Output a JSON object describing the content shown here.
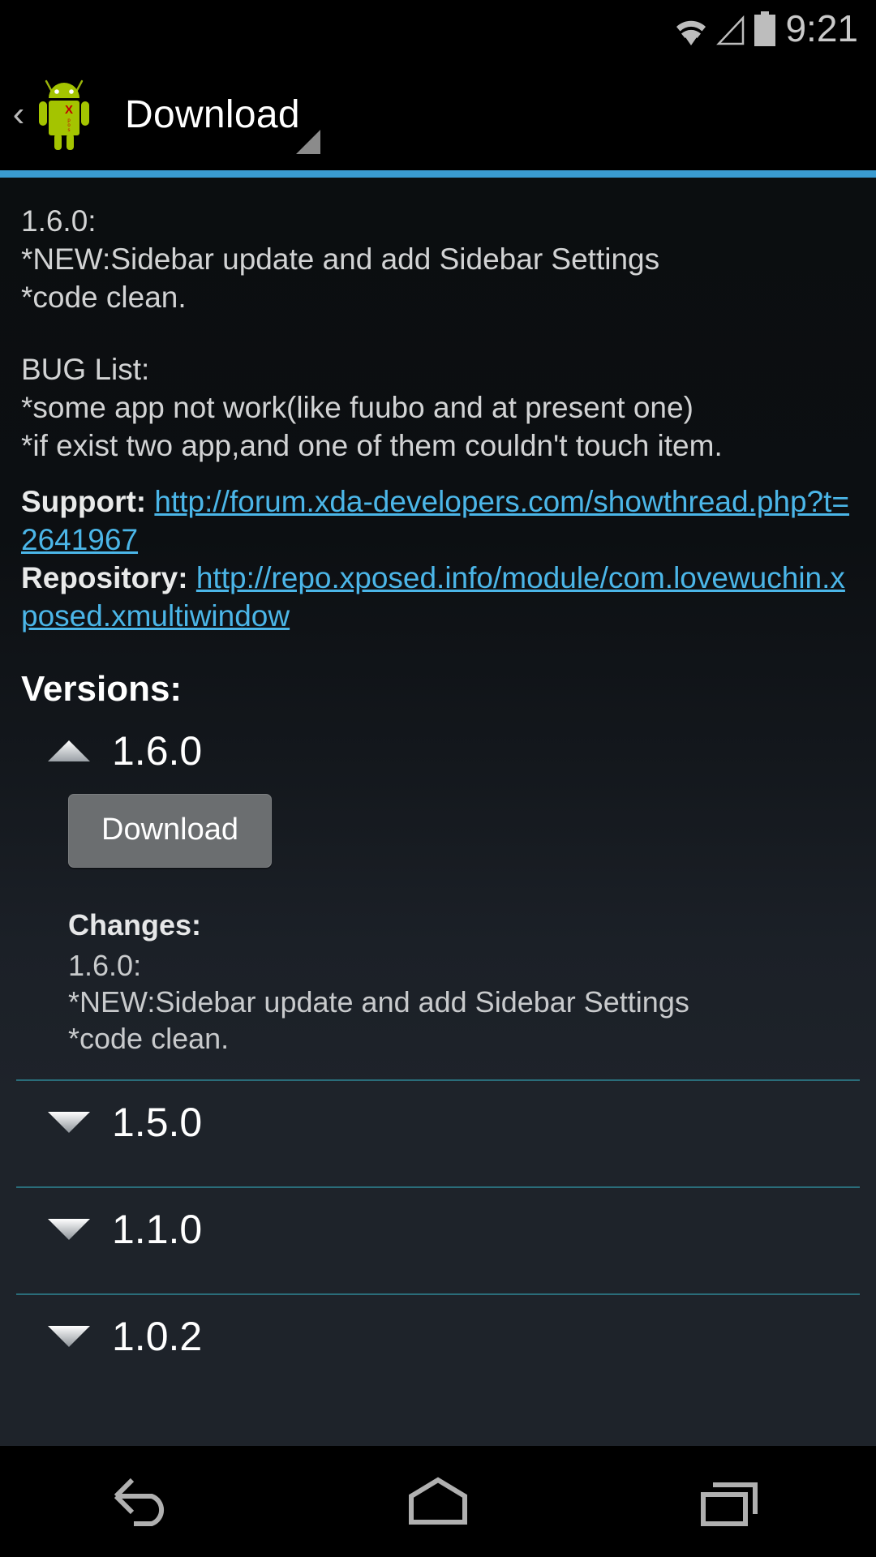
{
  "status_bar": {
    "time": "9:21",
    "icons": [
      "wifi-icon",
      "cell-signal-icon",
      "battery-icon"
    ]
  },
  "action_bar": {
    "title": "Download",
    "up_caret": "‹",
    "app_icon": "xposed-logo-icon",
    "accent_color": "#3a9bd0"
  },
  "description": {
    "version_header": "1.6.0:",
    "line_new": "*NEW:Sidebar update and add Sidebar Settings",
    "line_code_clean": "*code clean.",
    "bug_list_header": "BUG List:",
    "bug_1": "*some app not work(like fuubo and at present one)",
    "bug_2": "*if exist two app,and one of them couldn't touch item.",
    "support_label": "Support:",
    "support_url": "http://forum.xda-developers.com/showthread.php?t=2641967",
    "repository_label": "Repository:",
    "repository_url": "http://repo.xposed.info/module/com.lovewuchin.xposed.xmultiwindow"
  },
  "versions": {
    "header": "Versions:",
    "items": [
      {
        "name": "1.6.0",
        "expanded": true,
        "arrow": "chevron-up-icon",
        "download_label": "Download",
        "changes_label": "Changes:",
        "changes_text": "1.6.0:\n*NEW:Sidebar update and add Sidebar Settings\n*code clean."
      },
      {
        "name": "1.5.0",
        "expanded": false,
        "arrow": "chevron-down-icon"
      },
      {
        "name": "1.1.0",
        "expanded": false,
        "arrow": "chevron-down-icon"
      },
      {
        "name": "1.0.2",
        "expanded": false,
        "arrow": "chevron-down-icon"
      }
    ]
  },
  "nav_bar": {
    "back": "back-icon",
    "home": "home-icon",
    "recents": "recents-icon"
  },
  "colors": {
    "accent": "#3a9bd0",
    "link": "#4bb6e8",
    "divider": "#2a6d7a",
    "button": "#6b6e70"
  }
}
